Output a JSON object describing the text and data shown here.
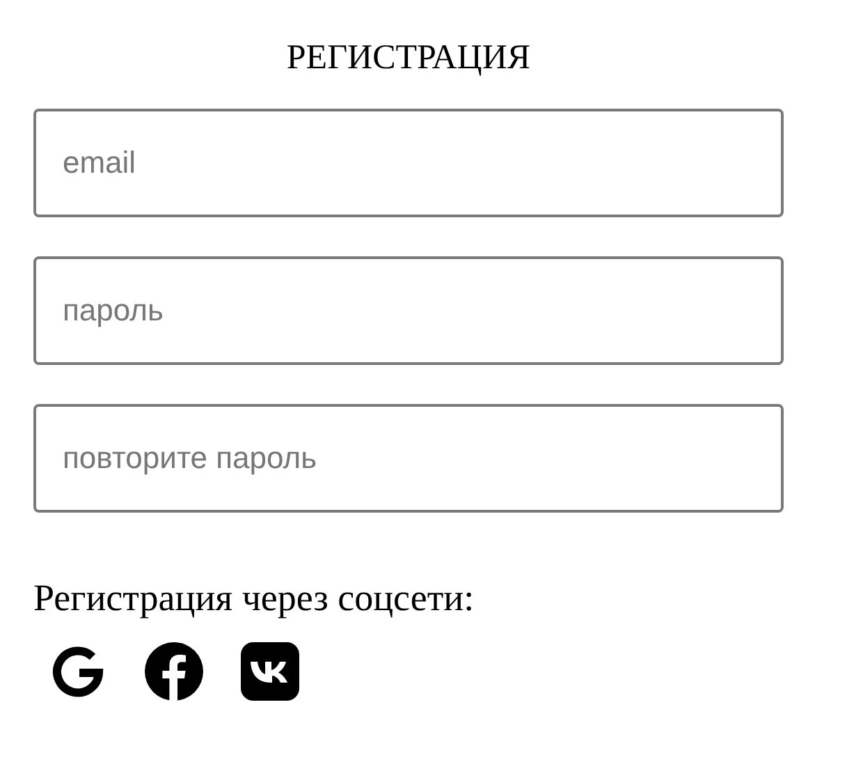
{
  "title": "РЕГИСТРАЦИЯ",
  "fields": [
    {
      "placeholder": "email"
    },
    {
      "placeholder": "пароль"
    },
    {
      "placeholder": "повторите пароль"
    }
  ],
  "social_label": "Регистрация через соцсети:",
  "social_buttons": [
    {
      "kind": "google"
    },
    {
      "kind": "facebook"
    },
    {
      "kind": "vk"
    }
  ]
}
